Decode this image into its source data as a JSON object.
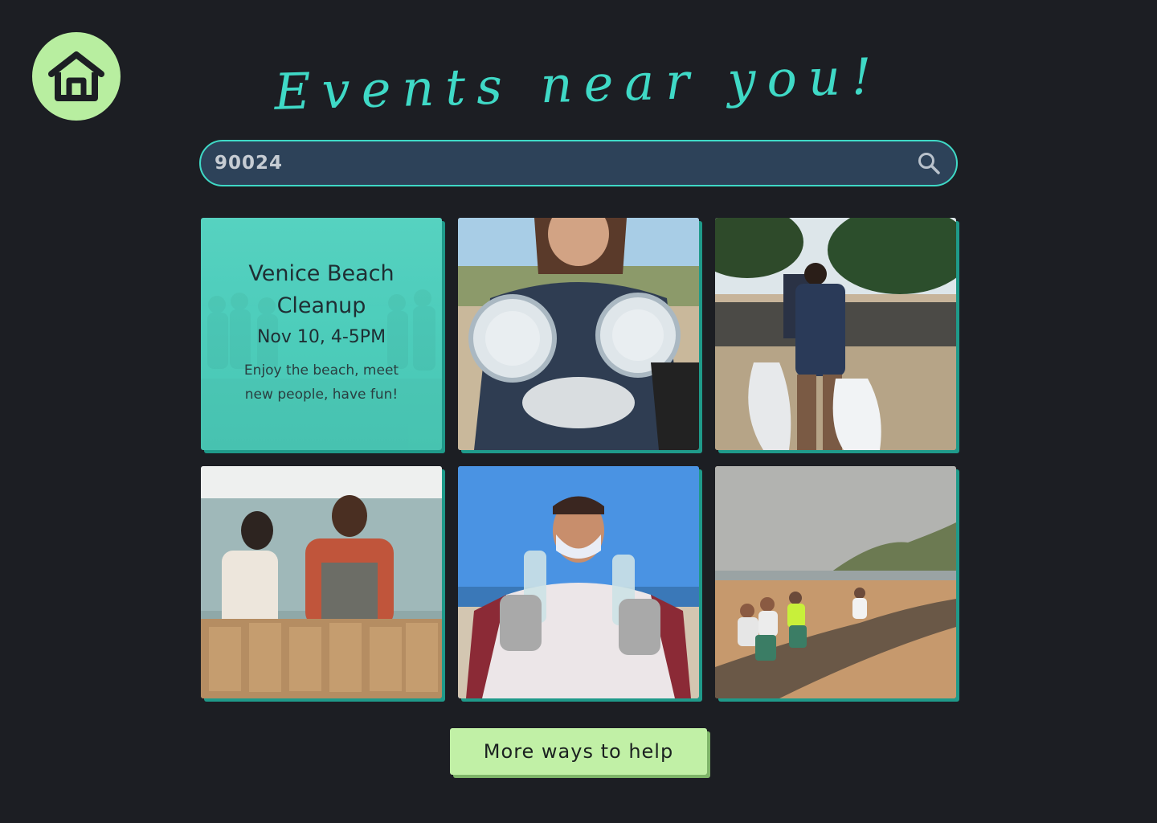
{
  "header": {
    "home_icon": "home-icon",
    "title": "Events near you!"
  },
  "search": {
    "value": "90024",
    "icon": "search-icon"
  },
  "featured_event": {
    "name": "Venice Beach Cleanup",
    "date": "Nov 10, 4-5PM",
    "description": "Enjoy the beach, meet new people, have fun!"
  },
  "photos": [
    {
      "subject": "person-holding-plastic-lids"
    },
    {
      "subject": "volunteers-carrying-trash-bags"
    },
    {
      "subject": "volunteers-packing-paper-bags"
    },
    {
      "subject": "person-holding-plastic-bottles"
    },
    {
      "subject": "beach-cleanup-crew"
    }
  ],
  "footer": {
    "more_label": "More ways to help"
  },
  "colors": {
    "background": "#1c1e23",
    "accent_teal": "#3fd9c6",
    "accent_green": "#b8eea0",
    "search_bg": "#2d4259"
  }
}
